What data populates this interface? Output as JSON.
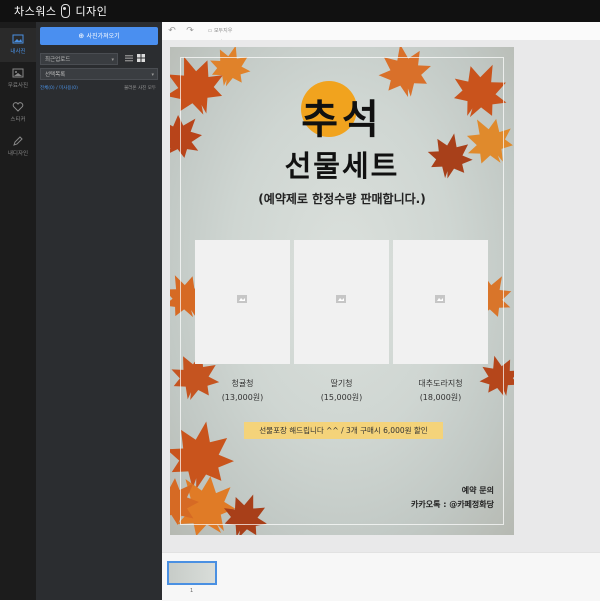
{
  "app": {
    "brand_left": "차스워스",
    "brand_right": "디자인"
  },
  "rail": {
    "items": [
      {
        "label": "내사진",
        "icon": "photo-icon",
        "active": true
      },
      {
        "label": "무료사진",
        "icon": "image-icon",
        "active": false
      },
      {
        "label": "스티커",
        "icon": "heart-icon",
        "active": false
      },
      {
        "label": "내디자인",
        "icon": "pencil-icon",
        "active": false
      }
    ]
  },
  "panel": {
    "upload_label": "사진가져오기",
    "sort_select": "최근업로드",
    "album_select": "선택목록",
    "selected_note": "전체(0) / 미사용(0)",
    "all_note": "불러온 사진 모두"
  },
  "toolbar": {
    "clear_label": "모두지우기"
  },
  "poster": {
    "title": "추석",
    "subtitle": "선물세트",
    "tagline": "(예약제로 한정수량 판매합니다.)",
    "products": [
      {
        "name": "청귤청",
        "price": "(13,000원)"
      },
      {
        "name": "딸기청",
        "price": "(15,000원)"
      },
      {
        "name": "대추도라지청",
        "price": "(18,000원)"
      }
    ],
    "banner": "선물포장 해드립니다 ^^  /  3개 구매시 6,000원 할인",
    "contact_title": "예약 문의",
    "contact_kakao": "카카오톡 : @카페정화당",
    "accent_color": "#f1a31e",
    "banner_color": "#f4d37a"
  },
  "pages": {
    "current": "1"
  }
}
